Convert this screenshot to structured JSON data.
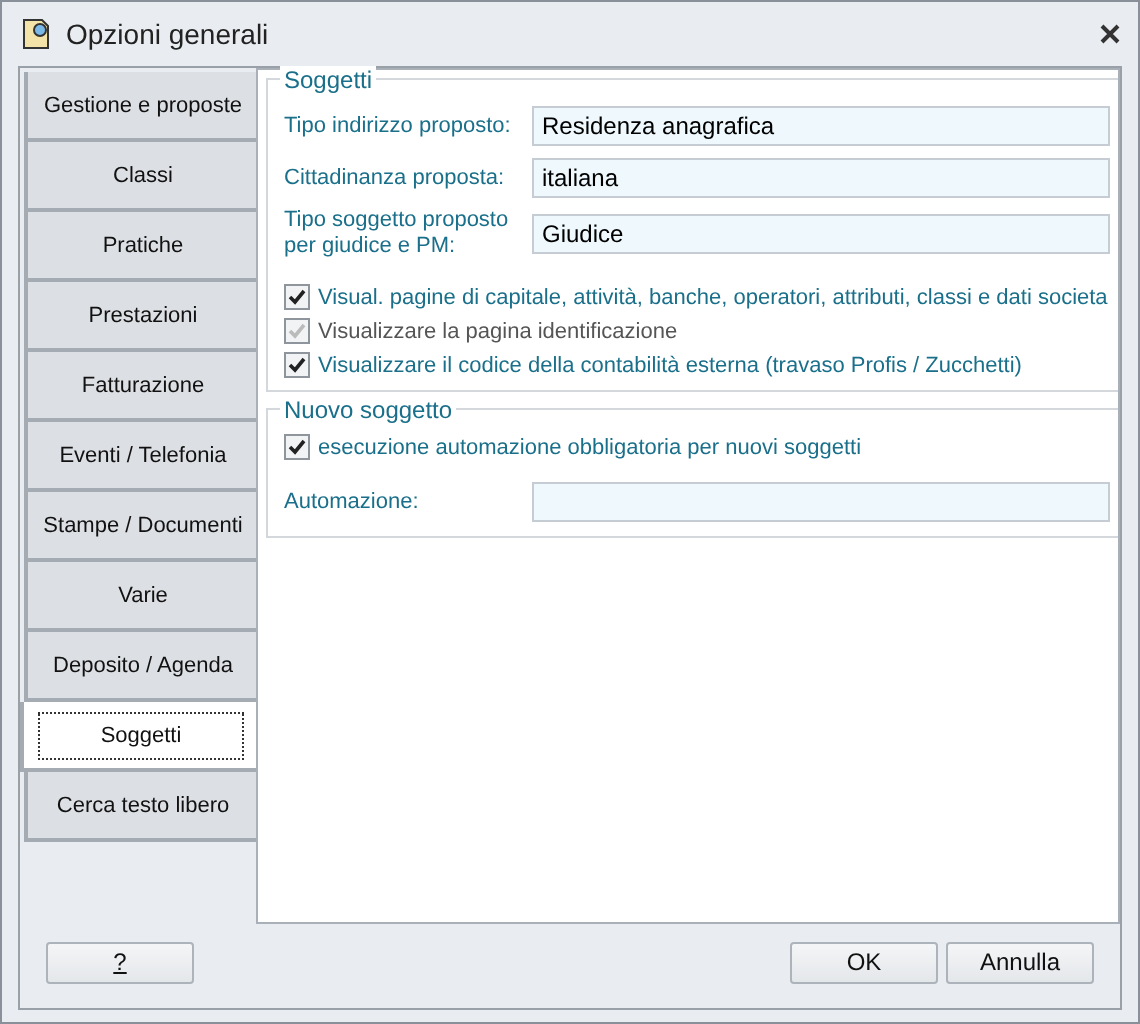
{
  "window": {
    "title": "Opzioni generali"
  },
  "sidebar": {
    "items": [
      {
        "label": "Gestione e proposte",
        "selected": false
      },
      {
        "label": "Classi",
        "selected": false
      },
      {
        "label": "Pratiche",
        "selected": false
      },
      {
        "label": "Prestazioni",
        "selected": false
      },
      {
        "label": "Fatturazione",
        "selected": false
      },
      {
        "label": "Eventi / Telefonia",
        "selected": false
      },
      {
        "label": "Stampe / Documenti",
        "selected": false
      },
      {
        "label": "Varie",
        "selected": false
      },
      {
        "label": "Deposito / Agenda",
        "selected": false
      },
      {
        "label": "Soggetti",
        "selected": true
      },
      {
        "label": "Cerca testo libero",
        "selected": false
      }
    ]
  },
  "groups": [
    {
      "title": "Soggetti",
      "fields": [
        {
          "label": "Tipo indirizzo proposto:",
          "value": "Residenza anagrafica"
        },
        {
          "label": "Cittadinanza proposta:",
          "value": "italiana"
        },
        {
          "label": "Tipo soggetto proposto per giudice e PM:",
          "value": "Giudice"
        }
      ],
      "checkboxes": [
        {
          "label": "Visual. pagine di capitale, attività, banche, operatori, attributi, classi e dati societa",
          "checked": true,
          "disabled": false
        },
        {
          "label": "Visualizzare la pagina identificazione",
          "checked": true,
          "disabled": true
        },
        {
          "label": "Visualizzare il codice della contabilità esterna (travaso Profis / Zucchetti)",
          "checked": true,
          "disabled": false
        }
      ]
    },
    {
      "title": "Nuovo soggetto",
      "checkboxes": [
        {
          "label": "esecuzione automazione obbligatoria per nuovi soggetti",
          "checked": true,
          "disabled": false
        }
      ],
      "fields": [
        {
          "label": "Automazione:"
        }
      ]
    }
  ],
  "buttons": {
    "help": "?",
    "ok": "OK",
    "cancel": "Annulla"
  }
}
